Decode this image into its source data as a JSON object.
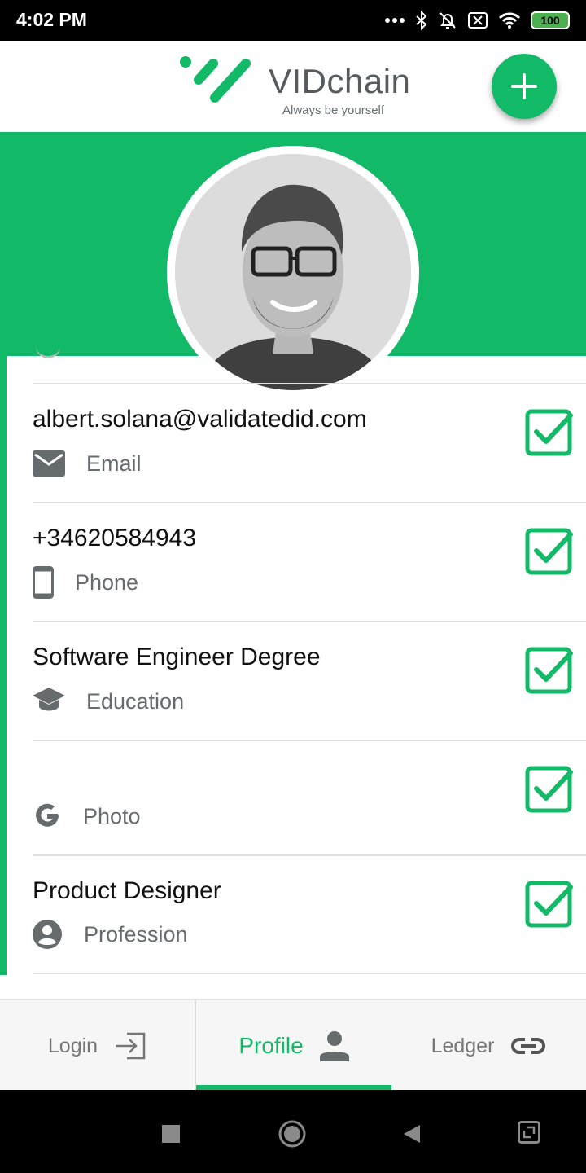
{
  "status_bar": {
    "time": "4:02 PM",
    "battery": "100"
  },
  "header": {
    "app_name": "VIDchain",
    "tagline": "Always be yourself",
    "add_icon": "plus-icon"
  },
  "profile": {
    "avatar": "profile-photo"
  },
  "credentials": [
    {
      "value": "albert.solana@validatedid.com",
      "type": "Email",
      "icon": "email-icon",
      "verified_icon": "checkbox-checked-icon"
    },
    {
      "value": "+34620584943",
      "type": "Phone",
      "icon": "phone-icon",
      "verified_icon": "checkbox-checked-icon"
    },
    {
      "value": "Software Engineer Degree",
      "type": "Education",
      "icon": "graduation-cap-icon",
      "verified_icon": "checkbox-checked-icon"
    },
    {
      "value": "",
      "type": "Photo",
      "icon": "google-icon",
      "verified_icon": "checkbox-checked-icon"
    },
    {
      "value": "Product Designer",
      "type": "Profession",
      "icon": "account-circle-icon",
      "verified_icon": "checkbox-checked-icon"
    }
  ],
  "bottom_nav": {
    "items": [
      {
        "label": "Login",
        "icon": "login-icon",
        "active": false
      },
      {
        "label": "Profile",
        "icon": "person-icon",
        "active": true
      },
      {
        "label": "Ledger",
        "icon": "link-icon",
        "active": false
      }
    ]
  },
  "colors": {
    "accent": "#12b967",
    "text_primary": "#111111",
    "text_secondary": "#666b6e"
  }
}
